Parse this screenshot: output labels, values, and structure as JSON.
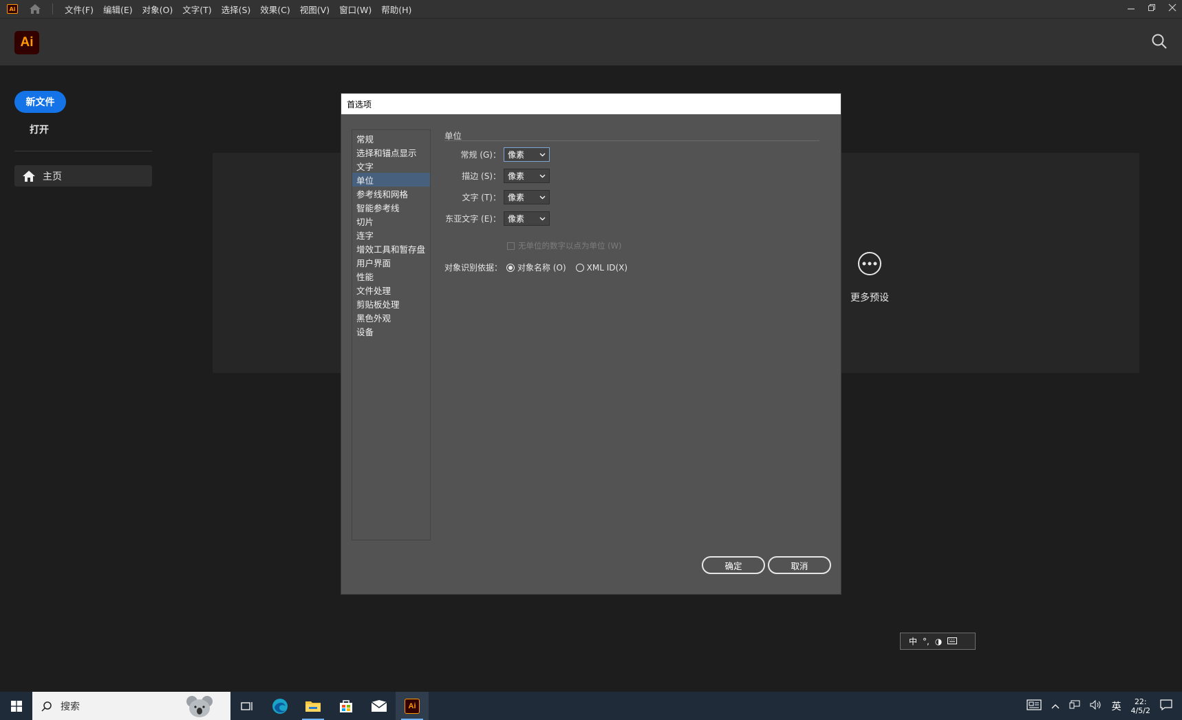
{
  "menubar": {
    "app_icon_text": "Ai",
    "items": [
      "文件(F)",
      "编辑(E)",
      "对象(O)",
      "文字(T)",
      "选择(S)",
      "效果(C)",
      "视图(V)",
      "窗口(W)",
      "帮助(H)"
    ]
  },
  "header": {
    "logo_text": "Ai"
  },
  "sidebar": {
    "new_file": "新文件",
    "open": "打开",
    "home": "主页"
  },
  "home_content": {
    "more_presets": "更多预设"
  },
  "dialog": {
    "title": "首选项",
    "categories": [
      "常规",
      "选择和锚点显示",
      "文字",
      "单位",
      "参考线和网格",
      "智能参考线",
      "切片",
      "连字",
      "增效工具和暂存盘",
      "用户界面",
      "性能",
      "文件处理",
      "剪贴板处理",
      "黑色外观",
      "设备"
    ],
    "selected_category": "单位",
    "section_title": "单位",
    "units": [
      {
        "label": "常规 (G)：",
        "value": "像素"
      },
      {
        "label": "描边 (S)：",
        "value": "像素"
      },
      {
        "label": "文字 (T)：",
        "value": "像素"
      },
      {
        "label": "东亚文字 (E)：",
        "value": "像素"
      }
    ],
    "unitless_checkbox": "无单位的数字以点为单位 (W)",
    "object_id_label": "对象识别依据：",
    "radio_object_name": "对象名称 (O)",
    "radio_xml_id": "XML ID(X)",
    "ok": "确定",
    "cancel": "取消"
  },
  "ime": {
    "mode": "中",
    "punct": "°,",
    "moon": "◑"
  },
  "taskbar": {
    "search_label": "搜索",
    "tray_lang": "英",
    "clock_time": "22:",
    "clock_date": "4/5/2"
  },
  "colors": {
    "accent": "#1473e6",
    "ai_brand": "#ff9a00",
    "ai_bg": "#330000",
    "dialog_bg": "#535353",
    "selection": "#46607d"
  }
}
